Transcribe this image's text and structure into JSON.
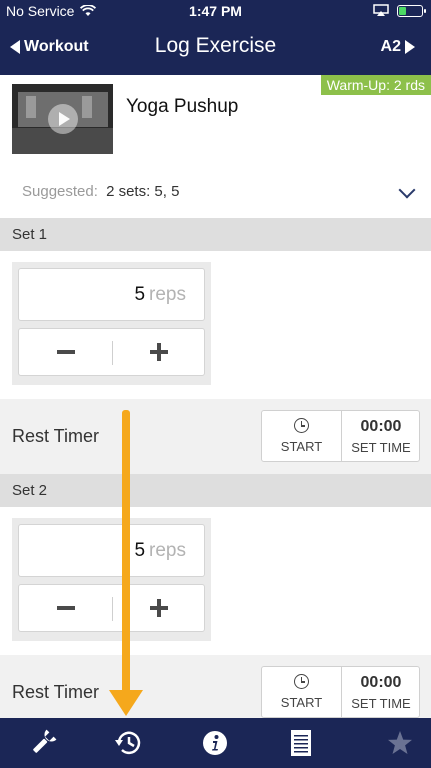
{
  "status_bar": {
    "carrier": "No Service",
    "time": "1:47 PM",
    "battery_percent": 0.35
  },
  "nav": {
    "back_label": "Workout",
    "title": "Log Exercise",
    "next_label": "A2"
  },
  "exercise": {
    "warmup_badge": "Warm-Up: 2 rds",
    "name": "Yoga Pushup",
    "suggested_label": "Suggested:",
    "suggested_value": "2 sets: 5, 5"
  },
  "sets": [
    {
      "header": "Set 1",
      "reps": "5",
      "unit": "reps"
    },
    {
      "header": "Set 2",
      "reps": "5",
      "unit": "reps"
    }
  ],
  "rest_timer": {
    "label": "Rest Timer",
    "start_label": "START",
    "time": "00:00",
    "set_time_label": "SET TIME"
  },
  "tabbar": {
    "icons": [
      "wrench-icon",
      "history-icon",
      "info-icon",
      "notes-icon",
      "star-icon"
    ]
  },
  "colors": {
    "nav_bg": "#1b2656",
    "warmup_badge": "#8dc04a",
    "annotation_arrow": "#f5a81c",
    "set_header_bg": "#dedede"
  }
}
